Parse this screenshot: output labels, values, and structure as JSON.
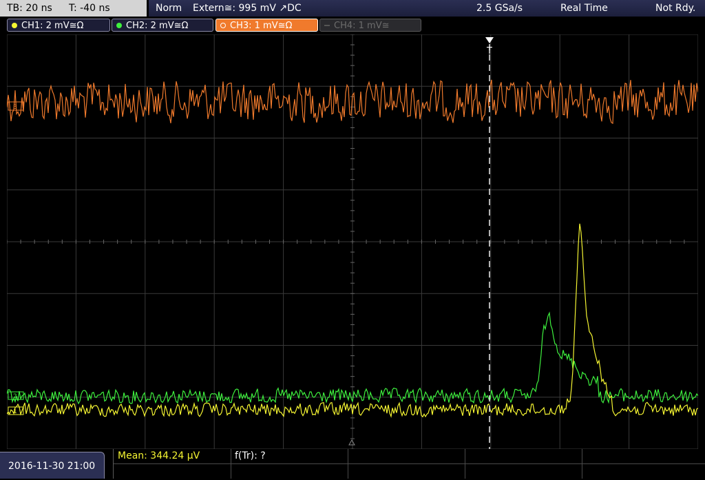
{
  "topbar": {
    "timebase": "TB: 20 ns",
    "trigger_offset": "T: -40 ns",
    "trigger_mode": "Norm",
    "trigger_source": "Extern≅: 995 mV ↗DC",
    "sample_rate": "2.5 GSa/s",
    "acq_mode": "Real Time",
    "status": "Not Rdy."
  },
  "channels": [
    {
      "label": "CH1: 2 mV≅Ω",
      "color": "#f5f532",
      "state": "on"
    },
    {
      "label": "CH2: 2 mV≅Ω",
      "color": "#3ef03e",
      "state": "on"
    },
    {
      "label": "CH3: 1 mV≅Ω",
      "color": "#f07a2c",
      "state": "active"
    },
    {
      "label": "CH4: 1 mV≅",
      "color": "#6c6c6c",
      "state": "off"
    }
  ],
  "screen": {
    "trigger_marker": "T",
    "ch3_marker": "3",
    "ch1_marker": "1",
    "ch2_marker": "2",
    "grid_divisions": {
      "x": 10,
      "y": 8
    }
  },
  "bottombar": {
    "datetime": "2016-11-30 21:00",
    "mean_measurement": "Mean: 344.24 μV",
    "freq_measurement": "f(Tr): ?"
  },
  "colors": {
    "ch1": "#f5f532",
    "ch2": "#3ef03e",
    "ch3": "#f07a2c",
    "grid": "#3a3a3a",
    "trigger": "#ffffff"
  }
}
